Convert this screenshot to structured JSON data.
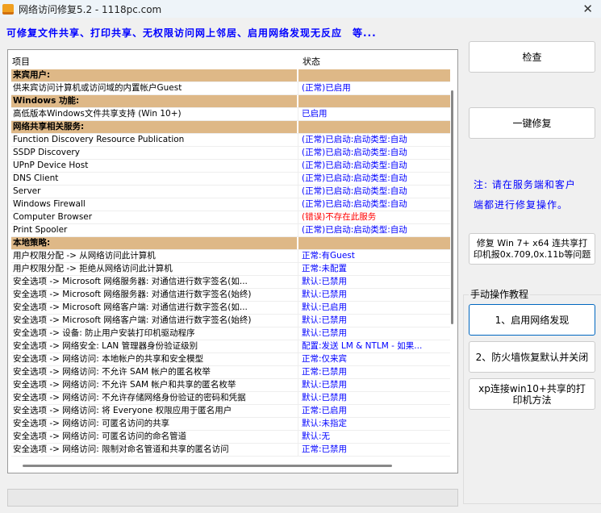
{
  "window": {
    "title": "网络访问修复5.2 - 1118pc.com"
  },
  "subtitle": "可修复文件共享、打印共享、无权限访问网上邻居、启用网络发现无反应　等...",
  "list": {
    "headers": [
      "项目",
      "状态"
    ],
    "rows": [
      {
        "type": "section",
        "item": "来宾用户:",
        "status": ""
      },
      {
        "item": "供来宾访问计算机或访问域的内置帐户Guest",
        "status": "(正常)已启用"
      },
      {
        "type": "section",
        "item": "Windows 功能:",
        "status": ""
      },
      {
        "item": "高低版本Windows文件共享支持 (Win 10+)",
        "status": "已启用"
      },
      {
        "type": "section",
        "item": "网络共享相关服务:",
        "status": ""
      },
      {
        "item": "Function Discovery Resource Publication",
        "status": "(正常)已启动:启动类型:自动"
      },
      {
        "item": "SSDP Discovery",
        "status": "(正常)已启动:启动类型:自动"
      },
      {
        "item": "UPnP Device Host",
        "status": "(正常)已启动:启动类型:自动"
      },
      {
        "item": "DNS Client",
        "status": "(正常)已启动:启动类型:自动"
      },
      {
        "item": "Server",
        "status": "(正常)已启动:启动类型:自动"
      },
      {
        "item": "Windows Firewall",
        "status": "(正常)已启动:启动类型:自动"
      },
      {
        "item": "Computer Browser",
        "status": "(错误)不存在此服务",
        "error": true
      },
      {
        "item": "Print Spooler",
        "status": "(正常)已启动:启动类型:自动"
      },
      {
        "type": "section",
        "item": "本地策略:",
        "status": ""
      },
      {
        "item": "用户权限分配 -> 从网络访问此计算机",
        "status": "正常:有Guest"
      },
      {
        "item": "用户权限分配 -> 拒绝从网络访问此计算机",
        "status": "正常:未配置"
      },
      {
        "item": "安全选项 -> Microsoft 网络服务器: 对通信进行数字签名(如...",
        "status": "默认:已禁用"
      },
      {
        "item": "安全选项 -> Microsoft 网络服务器: 对通信进行数字签名(始终)",
        "status": "默认:已禁用"
      },
      {
        "item": "安全选项 -> Microsoft 网络客户端: 对通信进行数字签名(如...",
        "status": "默认:已启用"
      },
      {
        "item": "安全选项 -> Microsoft 网络客户端: 对通信进行数字签名(始终)",
        "status": "默认:已禁用"
      },
      {
        "item": "安全选项 -> 设备: 防止用户安装打印机驱动程序",
        "status": "默认:已禁用"
      },
      {
        "item": "安全选项 -> 网络安全: LAN 管理器身份验证级别",
        "status": "配置:发送 LM & NTLM - 如果..."
      },
      {
        "item": "安全选项 -> 网络访问: 本地帐户的共享和安全模型",
        "status": "正常:仅来宾"
      },
      {
        "item": "安全选项 -> 网络访问: 不允许 SAM 帐户的匿名枚举",
        "status": "正常:已禁用"
      },
      {
        "item": "安全选项 -> 网络访问: 不允许 SAM 帐户和共享的匿名枚举",
        "status": "默认:已禁用"
      },
      {
        "item": "安全选项 -> 网络访问: 不允许存储网络身份验证的密码和凭据",
        "status": "默认:已禁用"
      },
      {
        "item": "安全选项 -> 网络访问: 将 Everyone 权限应用于匿名用户",
        "status": "正常:已启用"
      },
      {
        "item": "安全选项 -> 网络访问: 可匿名访问的共享",
        "status": "默认:未指定"
      },
      {
        "item": "安全选项 -> 网络访问: 可匿名访问的命名管道",
        "status": "默认:无"
      },
      {
        "item": "安全选项 -> 网络访问: 限制对命名管道和共享的匿名访问",
        "status": "正常:已禁用"
      }
    ]
  },
  "buttons": {
    "check": "检查",
    "fix_all": "一键修复",
    "fix_printer": "修复 Win 7+ x64 连共享打印机报0x.709,0x.11b等问题"
  },
  "note": [
    "注: 请在服务端和客户",
    "端都进行修复操作。"
  ],
  "manual": {
    "label": "手动操作教程",
    "enable_discovery": "1、启用网络发现",
    "firewall": "2、防火墙恢复默认并关闭",
    "xp_printer": "xp连接win10+共享的打印机方法"
  },
  "colors": {
    "section": "#deb887",
    "status": "#0000ff",
    "error": "#ff0000"
  }
}
